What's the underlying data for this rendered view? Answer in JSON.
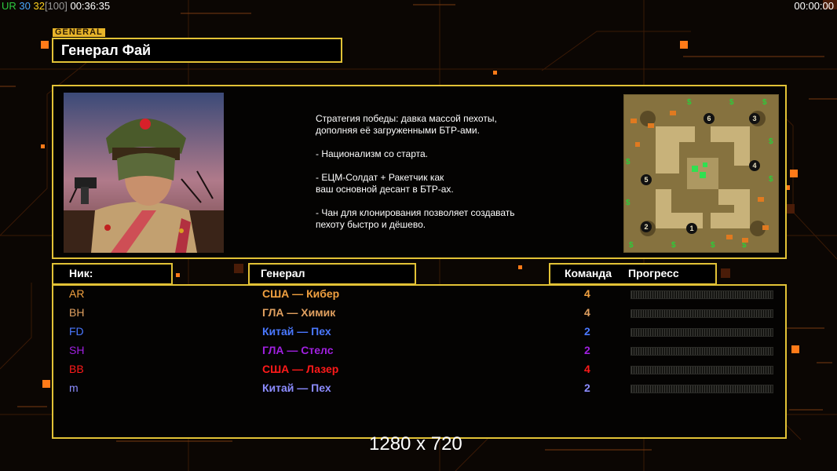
{
  "hud": {
    "left": [
      {
        "text": "UR",
        "color": "#2ecc40"
      },
      {
        "text": " 30",
        "color": "#4aa8ff"
      },
      {
        "text": " 32",
        "color": "#ffd21f"
      },
      {
        "text": "[100]",
        "color": "#9a9a9a"
      },
      {
        "text": " 00:36:35",
        "color": "#ffffff"
      }
    ],
    "right": "00:00:00"
  },
  "general_tag": "GENERAL",
  "title": "Генерал Фай",
  "description": [
    "Стратегия победы: давка массой пехоты,\n дополняя её загруженными БТР-ами.",
    "- Национализм со старта.",
    "- ЕЦМ-Солдат + Ракетчик как\nваш основной десант в БТР-ах.",
    "- Чан для клонирования позволяет создавать\n пехоту быстро и дёшево."
  ],
  "minimap_slots": [
    "6",
    "3",
    "4",
    "5",
    "2",
    "1"
  ],
  "headers": {
    "nick": "Ник:",
    "general": "Генерал",
    "team": "Команда",
    "progress": "Прогресс"
  },
  "players": [
    {
      "nick": "AR",
      "general": "США — Кибер",
      "team": "4",
      "color": "#f0a040"
    },
    {
      "nick": "BH",
      "general": "ГЛА — Химик",
      "team": "4",
      "color": "#e0a060"
    },
    {
      "nick": "FD",
      "general": "Китай — Пех",
      "team": "2",
      "color": "#4a78ff"
    },
    {
      "nick": "SH",
      "general": "ГЛА — Стелс",
      "team": "2",
      "color": "#a020e0"
    },
    {
      "nick": "BB",
      "general": "США — Лазер",
      "team": "4",
      "color": "#ff1a1a"
    },
    {
      "nick": "m",
      "general": "Китай — Пех",
      "team": "2",
      "color": "#8c8cff"
    }
  ],
  "resolution": "1280 x 720",
  "colors": {
    "frame": "#e2c236",
    "accent": "#ff8a1e"
  }
}
